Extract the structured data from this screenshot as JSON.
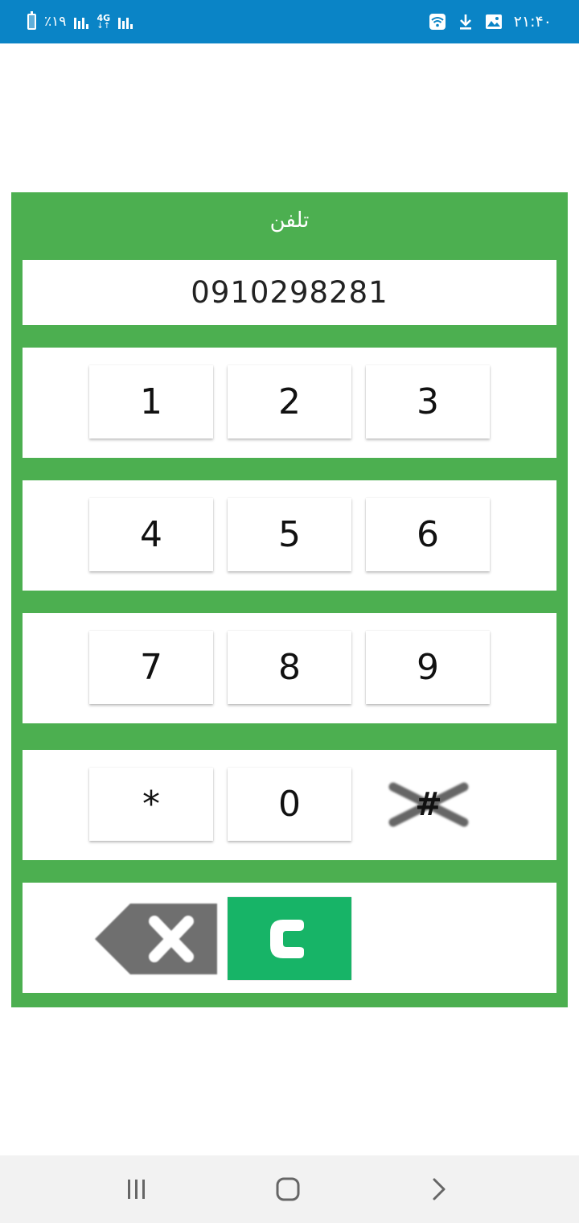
{
  "status_bar": {
    "battery_percent": "٪۱۹",
    "network_type": "4G",
    "time": "۲۱:۴۰",
    "icons": [
      "battery-icon",
      "signal-icon",
      "4g-data-icon",
      "signal-icon",
      "wifi-icon",
      "download-icon",
      "image-icon"
    ],
    "background_color": "#0a84c6"
  },
  "dialer": {
    "title": "تلفن",
    "number": "0910298281",
    "accent_color": "#4caf50",
    "rows": [
      [
        "1",
        "2",
        "3"
      ],
      [
        "4",
        "5",
        "6"
      ],
      [
        "7",
        "8",
        "9"
      ],
      [
        "*",
        "0",
        "#"
      ]
    ],
    "call_button_color": "#17b467",
    "actions": [
      "backspace-icon",
      "phone-icon"
    ]
  },
  "nav_bar": {
    "icons": [
      "recent-apps-icon",
      "home-icon",
      "back-icon"
    ]
  }
}
